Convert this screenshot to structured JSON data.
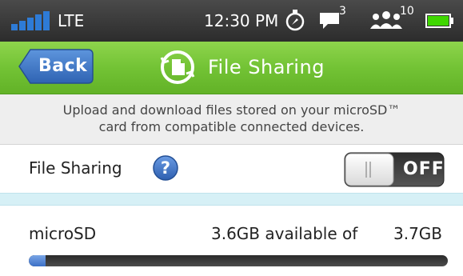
{
  "status_bar": {
    "signal_icon": "signal-bars-icon",
    "network": "LTE",
    "time": "12:30 PM",
    "compass_icon": "compass-icon",
    "messages_icon": "chat-bubble-icon",
    "messages_count": "3",
    "people_icon": "people-icon",
    "people_count": "10",
    "battery_icon": "battery-icon",
    "battery_color": "#3fd600"
  },
  "title_bar": {
    "back_label": "Back",
    "title_icon": "file-sharing-icon",
    "title": "File Sharing",
    "accent_color": "#72c234",
    "back_color": "#3c73c0"
  },
  "description": {
    "line1": "Upload and download files stored on your microSD™",
    "line2": "card from compatible connected devices."
  },
  "file_sharing": {
    "label": "File Sharing",
    "help_icon": "help-icon",
    "toggle_state": "OFF"
  },
  "storage": {
    "label": "microSD",
    "available_text": "3.6GB available of",
    "total_text": "3.7GB",
    "used_fraction": 0.04
  }
}
